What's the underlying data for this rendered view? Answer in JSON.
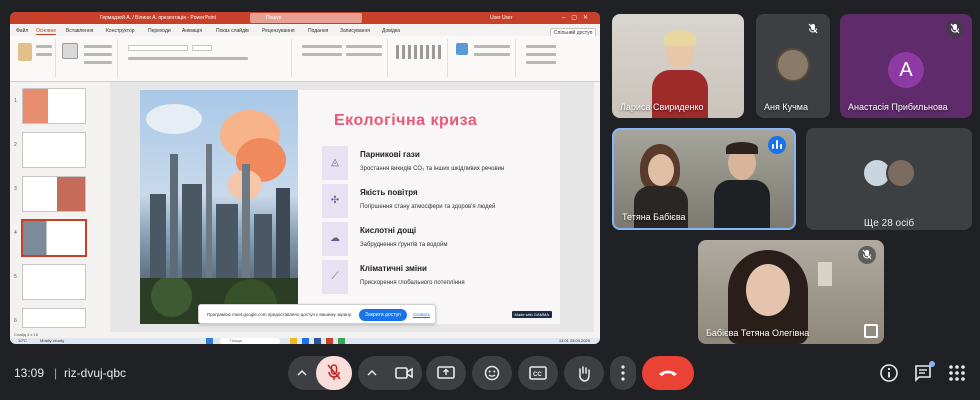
{
  "meeting": {
    "time": "13:09",
    "separator": "|",
    "code": "riz-dvuj-qbc"
  },
  "presentation": {
    "window_title": "Гермадзей А. / Білини А. презентація  -  PowerPoint",
    "search_placeholder": "Пошук",
    "user": "User User",
    "share_label": "Спільний доступ",
    "tabs": [
      "Файл",
      "Основне",
      "Вставлення",
      "Конструктор",
      "Переходи",
      "Анімація",
      "Показ слайдів",
      "Рецензування",
      "Подання",
      "Записування",
      "Довідка"
    ],
    "active_tab": "Основне",
    "slide": {
      "title": "Екологічна криза",
      "items": [
        {
          "heading": "Парникові гази",
          "desc": "Зростання викидів CO₂ та інших шкідливих речовин",
          "icon": "triangle-chart-icon"
        },
        {
          "heading": "Якість повітря",
          "desc": "Погіршення стану атмосфери та здоров'я людей",
          "icon": "fan-icon"
        },
        {
          "heading": "Кислотні дощі",
          "desc": "Забруднення ґрунтів та водойм",
          "icon": "cloud-rain-icon"
        },
        {
          "heading": "Кліматичні зміни",
          "desc": "Прискорення глобального потепління",
          "icon": "thermometer-icon"
        }
      ],
      "badge": "Made with GAMMA"
    },
    "thumbnails": [
      "1",
      "2",
      "3",
      "4",
      "5",
      "6"
    ],
    "selected_thumbnail": "4",
    "status_left": "Слайд 4 з 16",
    "taskbar_search": "Пошук",
    "taskbar_time": "13:01",
    "taskbar_date": "25.03.2025",
    "weather_temp": "10°C",
    "weather_desc": "Mostly cloudy",
    "notice": {
      "text": "Програмою meet.google.com предоставлено доступ к вашему экрану.",
      "stop_button": "Закрити доступ",
      "hide_link": "Сховать"
    }
  },
  "participants": [
    {
      "name": "Лариса Свириденко"
    },
    {
      "name": "Аня Кучма"
    },
    {
      "name": "Анастасія Прибильнова",
      "initial": "A"
    },
    {
      "name": "Тетяна Бабієва"
    },
    {
      "name": "Ще 28 осіб"
    },
    {
      "name": "Бабієва Тетяна Олегівна"
    }
  ],
  "colors": {
    "bg": "#202124",
    "tile": "#3c4043",
    "end_call": "#ea4335",
    "mic_off_red": "#f28b82",
    "accent_blue": "#1a73e8",
    "ppt_red": "#c6402a",
    "slide_title": "#e8587a"
  }
}
